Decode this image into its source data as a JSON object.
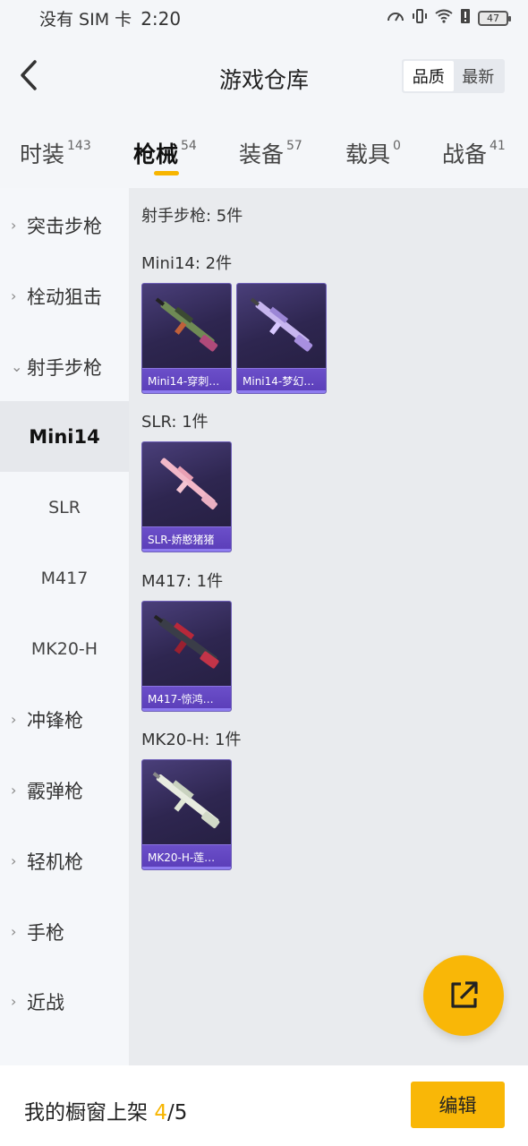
{
  "status": {
    "carrier": "没有 SIM 卡",
    "time": "2:20",
    "battery": "47"
  },
  "header": {
    "title": "游戏仓库",
    "sort_options": [
      "品质",
      "最新"
    ],
    "sort_selected": "品质"
  },
  "tabs": [
    {
      "label": "时装",
      "count": "143"
    },
    {
      "label": "枪械",
      "count": "54"
    },
    {
      "label": "装备",
      "count": "57"
    },
    {
      "label": "载具",
      "count": "0"
    },
    {
      "label": "战备",
      "count": "41"
    }
  ],
  "active_tab": "枪械",
  "sidebar": {
    "categories": [
      {
        "label": "突击步枪",
        "expanded": false
      },
      {
        "label": "栓动狙击",
        "expanded": false
      },
      {
        "label": "射手步枪",
        "expanded": true
      },
      {
        "label": "冲锋枪",
        "expanded": false
      },
      {
        "label": "霰弹枪",
        "expanded": false
      },
      {
        "label": "轻机枪",
        "expanded": false
      },
      {
        "label": "手枪",
        "expanded": false
      },
      {
        "label": "近战",
        "expanded": false
      }
    ],
    "subitems": [
      "Mini14",
      "SLR",
      "M417",
      "MK20-H"
    ],
    "active_subitem": "Mini14"
  },
  "content": {
    "category_title": "射手步枪: 5件",
    "groups": [
      {
        "title": "Mini14: 2件",
        "items": [
          "Mini14-穿刺…",
          "Mini14-梦幻…"
        ]
      },
      {
        "title": "SLR: 1件",
        "items": [
          "SLR-娇憨猪猪"
        ]
      },
      {
        "title": "M417: 1件",
        "items": [
          "M417-惊鸿…"
        ]
      },
      {
        "title": "MK20-H: 1件",
        "items": [
          "MK20-H-莲…"
        ]
      }
    ]
  },
  "bottom": {
    "shelf_label": "我的橱窗上架",
    "shelf_current": "4",
    "shelf_total": "/5",
    "edit_label": "编辑"
  },
  "colors": {
    "accent": "#f9b707",
    "card_bg": "#2e2650",
    "card_label": "#5a3db8"
  }
}
